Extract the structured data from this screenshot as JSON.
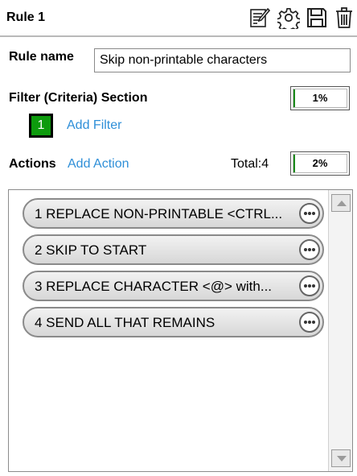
{
  "header": {
    "title": "Rule 1",
    "tools": [
      "edit-notes-icon",
      "gear-icon",
      "save-icon",
      "trash-icon"
    ]
  },
  "rule_name": {
    "label": "Rule name",
    "value": "Skip non-printable characters"
  },
  "filter": {
    "label": "Filter (Criteria) Section",
    "percent_text": "1%",
    "percent_value": 0.01,
    "count": "1",
    "add_label": "Add Filter"
  },
  "actions": {
    "label": "Actions",
    "add_label": "Add Action",
    "total_text": "Total:4",
    "percent_text": "2%",
    "percent_value": 0.02,
    "items": [
      {
        "text": "1 REPLACE NON-PRINTABLE <CTRL..."
      },
      {
        "text": "2 SKIP TO START"
      },
      {
        "text": "3 REPLACE CHARACTER <@> with..."
      },
      {
        "text": "4 SEND ALL THAT REMAINS"
      }
    ]
  },
  "colors": {
    "accent_link": "#2f8fd8",
    "badge_green": "#0d9b0d",
    "progress_green": "#1a8a1a"
  }
}
